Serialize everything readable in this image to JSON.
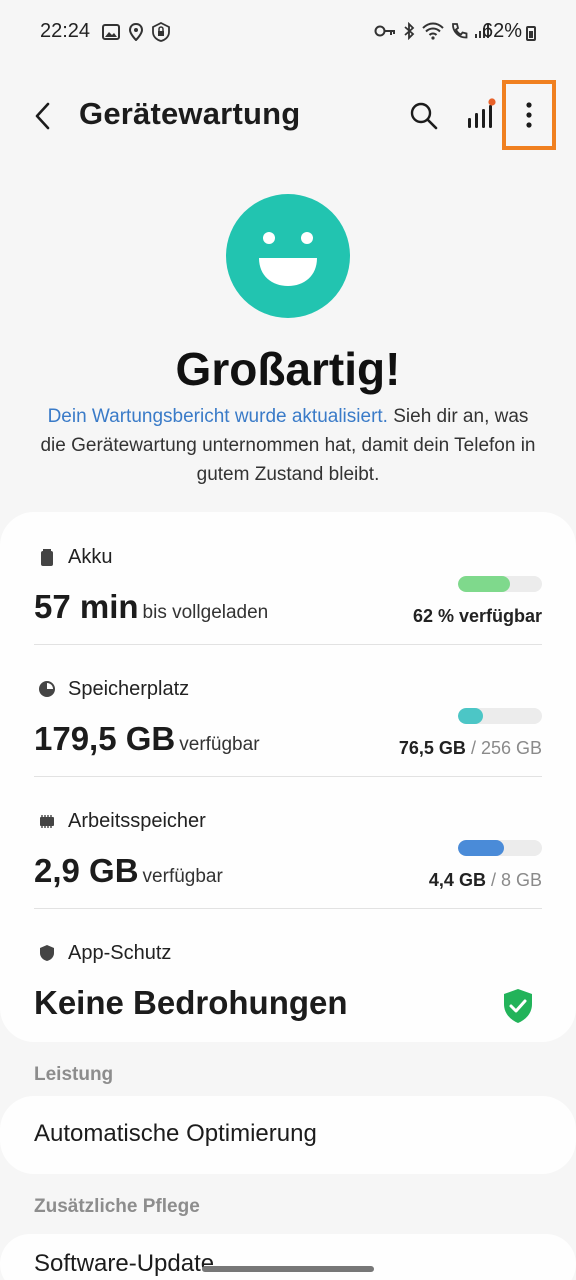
{
  "status_bar": {
    "time": "22:24",
    "battery_percent": "62%",
    "left_icons": [
      "image-icon",
      "location-icon",
      "shield-lock-icon"
    ],
    "right_icons": [
      "key-icon",
      "bluetooth-icon",
      "wifi-icon",
      "call-icon",
      "signal-icon",
      "battery-icon"
    ]
  },
  "app_bar": {
    "title": "Gerätewartung",
    "icons": [
      "back-arrow-icon",
      "search-icon",
      "stats-icon",
      "more-options-icon"
    ]
  },
  "hero": {
    "headline": "Großartig!",
    "link_text": "Dein Wartungsbericht wurde aktualisiert.",
    "description_rest": " Sieh dir an, was die Gerätewartung unternommen hat, damit dein Telefon in gutem Zustand bleibt."
  },
  "card": {
    "battery": {
      "label": "Akku",
      "value": "57 min",
      "sub": "bis vollgeladen",
      "meta": "62 % verfügbar",
      "bar_fraction": 0.62,
      "bar_color": "#7fd98c"
    },
    "storage": {
      "label": "Speicherplatz",
      "value": "179,5 GB",
      "sub": "verfügbar",
      "used": "76,5 GB",
      "total": "/ 256 GB",
      "bar_fraction": 0.3,
      "bar_color": "#4cc6c6"
    },
    "memory": {
      "label": "Arbeitsspeicher",
      "value": "2,9 GB",
      "sub": "verfügbar",
      "used": "4,4 GB",
      "total": "/ 8 GB",
      "bar_fraction": 0.55,
      "bar_color": "#4a8bd8"
    },
    "app_protection": {
      "label": "App-Schutz",
      "value": "Keine Bedrohungen",
      "status_color": "#22b35a"
    }
  },
  "sections": {
    "performance": {
      "header": "Leistung",
      "item": "Automatische Optimierung"
    },
    "additional_care": {
      "header": "Zusätzliche Pflege",
      "item": "Software-Update"
    }
  },
  "colors": {
    "accent_orange": "#f08020",
    "smiley": "#22c4b0",
    "link": "#3a7bc8"
  }
}
